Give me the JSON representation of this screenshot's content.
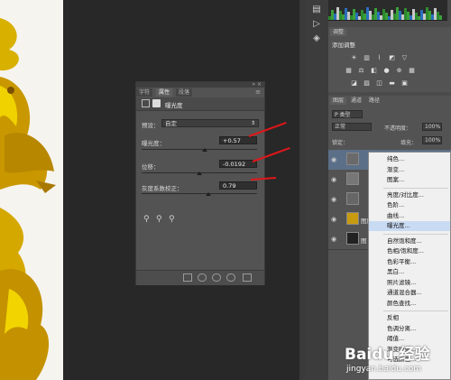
{
  "properties_panel": {
    "tabs": [
      "字符",
      "属性",
      "段落"
    ],
    "active_tab": "属性",
    "header_title": "曝光度",
    "preset_label": "预设：",
    "preset_value": "自定",
    "rows": [
      {
        "label": "曝光度：",
        "value": "+0.57",
        "slider_fraction": 0.55
      },
      {
        "label": "位移：",
        "value": "-0.0192",
        "slider_fraction": 0.5
      },
      {
        "label": "灰度系数校正：",
        "value": "0.79",
        "slider_fraction": 0.58
      }
    ]
  },
  "adjustments_panel": {
    "tabs": [
      "调整"
    ],
    "subtitle": "添加调整"
  },
  "layers_panel": {
    "tabs": [
      "图层",
      "通道",
      "路径"
    ],
    "filter_label": "P 类型",
    "blend_mode": "正常",
    "opacity_label": "不透明度：",
    "opacity_value": "100%",
    "lock_label": "锁定：",
    "fill_label": "填充：",
    "fill_value": "100%",
    "layer_names": [
      "",
      "",
      "",
      "图层",
      "图"
    ]
  },
  "context_menu": {
    "items": [
      "纯色...",
      "渐变...",
      "图案...",
      "亮度/对比度...",
      "色阶...",
      "曲线...",
      "曝光度...",
      "自然饱和度...",
      "色相/饱和度...",
      "色彩平衡...",
      "黑白...",
      "照片滤镜...",
      "通道混合器...",
      "颜色查找...",
      "反相",
      "色调分离...",
      "阈值...",
      "渐变映射...",
      "可选颜色..."
    ],
    "highlighted": "曝光度..."
  },
  "watermark": {
    "brand": "Baidu 经验",
    "url": "jingyan.baidu.com"
  },
  "colors": {
    "arrow": "#e0161a",
    "panel_bg": "#535353",
    "menu_highlight": "#c9dbf3"
  }
}
